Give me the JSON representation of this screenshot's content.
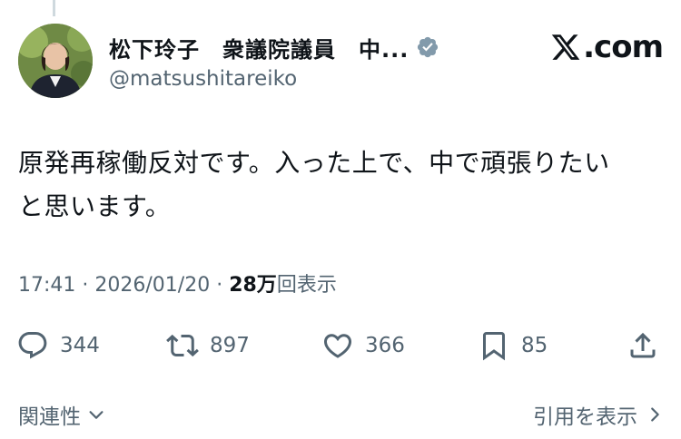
{
  "author": {
    "display_name": "松下玲子　衆議院議員　中...",
    "handle": "@matsushitareiko",
    "verified": true,
    "avatar_icon": "profile-photo"
  },
  "brand": {
    "logo_text": ".com",
    "logo_icon": "x-logo-icon"
  },
  "tweet": {
    "text_line1": "原発再稼働反対です。入った上で、中で頑張りたい",
    "text_line2": "と思います。"
  },
  "meta": {
    "time": "17:41",
    "separator": " · ",
    "date": "2026/01/20",
    "separator2": " · ",
    "views_count": "28万",
    "views_label": "回表示"
  },
  "actions": {
    "reply_count": "344",
    "retweet_count": "897",
    "like_count": "366",
    "bookmark_count": "85"
  },
  "footer": {
    "related_label": "関連性",
    "quotes_label": "引用を表示"
  },
  "colors": {
    "text": "#0f1419",
    "secondary": "#536471",
    "verified_badge": "#829aab"
  }
}
